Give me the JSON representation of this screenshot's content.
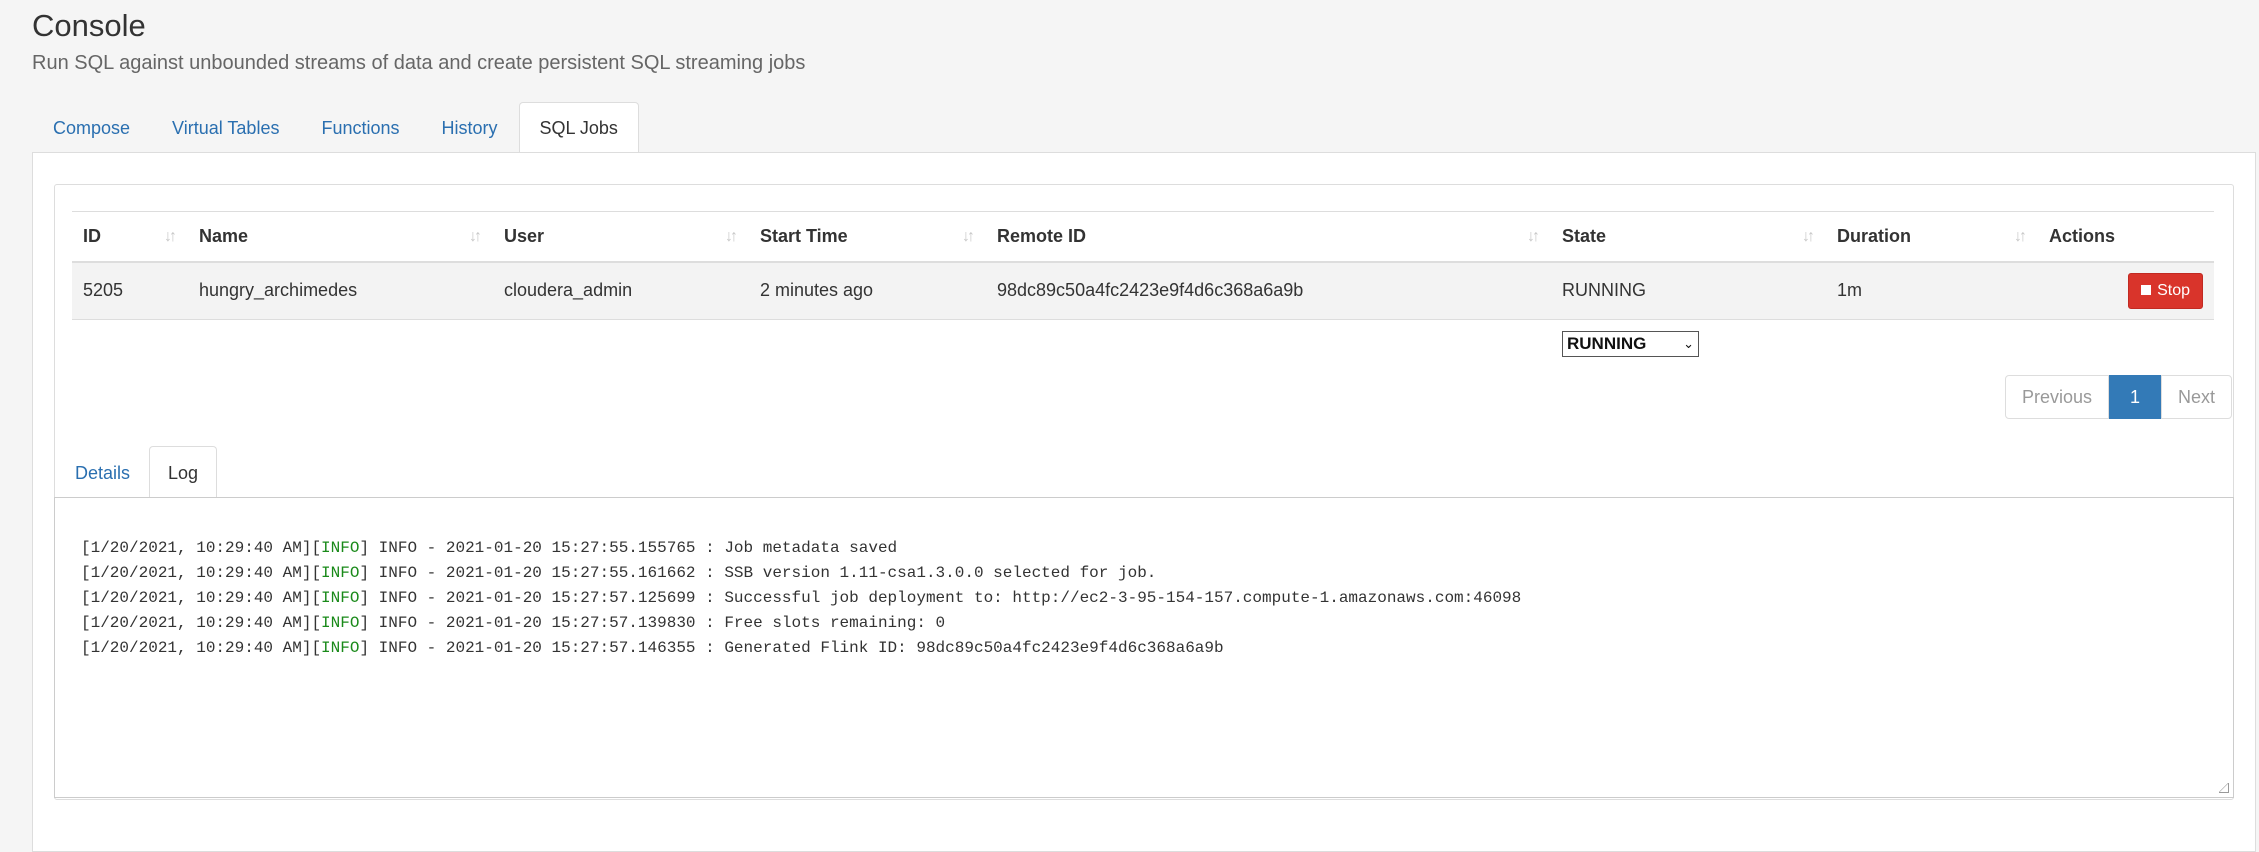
{
  "header": {
    "title": "Console",
    "subtitle": "Run SQL against unbounded streams of data and create persistent SQL streaming jobs"
  },
  "tabs": [
    {
      "label": "Compose",
      "active": false
    },
    {
      "label": "Virtual Tables",
      "active": false
    },
    {
      "label": "Functions",
      "active": false
    },
    {
      "label": "History",
      "active": false
    },
    {
      "label": "SQL Jobs",
      "active": true
    }
  ],
  "jobs_table": {
    "columns": [
      "ID",
      "Name",
      "User",
      "Start Time",
      "Remote ID",
      "State",
      "Duration",
      "Actions"
    ],
    "rows": [
      {
        "id": "5205",
        "name": "hungry_archimedes",
        "user": "cloudera_admin",
        "start_time": "2 minutes ago",
        "remote_id": "98dc89c50a4fc2423e9f4d6c368a6a9b",
        "state": "RUNNING",
        "duration": "1m",
        "action_label": "Stop"
      }
    ],
    "state_filter": {
      "selected": "RUNNING"
    }
  },
  "pagination": {
    "previous": "Previous",
    "current": "1",
    "next": "Next"
  },
  "detail_tabs": [
    {
      "label": "Details",
      "active": false
    },
    {
      "label": "Log",
      "active": true
    }
  ],
  "log": {
    "lines": [
      {
        "timestamp": "[1/20/2021, 10:29:40 AM]",
        "level": "INFO",
        "message": " INFO - 2021-01-20 15:27:55.155765 : Job metadata saved"
      },
      {
        "timestamp": "[1/20/2021, 10:29:40 AM]",
        "level": "INFO",
        "message": " INFO - 2021-01-20 15:27:55.161662 : SSB version 1.11-csa1.3.0.0 selected for job."
      },
      {
        "timestamp": "[1/20/2021, 10:29:40 AM]",
        "level": "INFO",
        "message": " INFO - 2021-01-20 15:27:57.125699 : Successful job deployment to: http://ec2-3-95-154-157.compute-1.amazonaws.com:46098"
      },
      {
        "timestamp": "[1/20/2021, 10:29:40 AM]",
        "level": "INFO",
        "message": " INFO - 2021-01-20 15:27:57.139830 : Free slots remaining: 0"
      },
      {
        "timestamp": "[1/20/2021, 10:29:40 AM]",
        "level": "INFO",
        "message": " INFO - 2021-01-20 15:27:57.146355 : Generated Flink ID: 98dc89c50a4fc2423e9f4d6c368a6a9b"
      }
    ]
  },
  "colors": {
    "link": "#2a6fb0",
    "stop_button": "#d9342b",
    "pager_active": "#337ab7",
    "log_level": "#1a8a1a"
  }
}
